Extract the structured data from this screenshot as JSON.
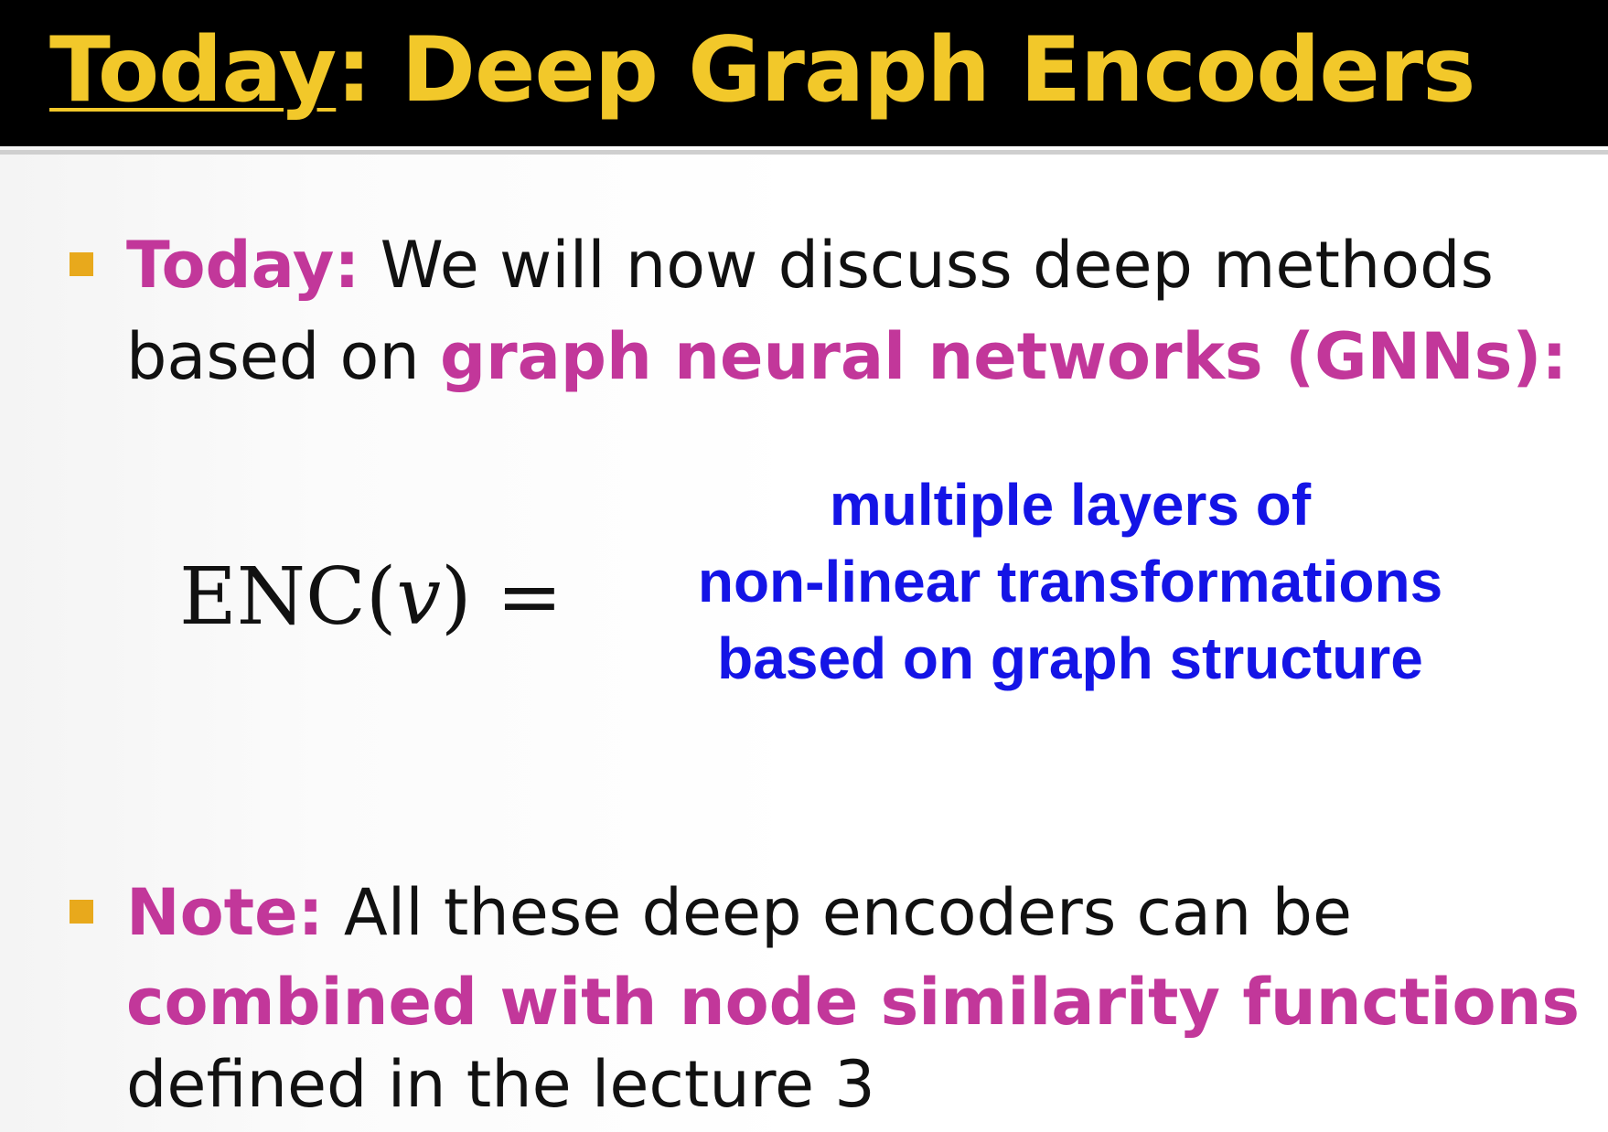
{
  "slide": {
    "title": {
      "underlined": "Today",
      "rest": ": Deep Graph Encoders"
    },
    "bullet1": {
      "lead": "Today:",
      "text1": " We will now discuss deep methods",
      "text2": "based on ",
      "emph": "graph neural networks (GNNs):"
    },
    "formula": {
      "func": "ENC",
      "open": "(",
      "var": "v",
      "close": ")",
      "eq": " ="
    },
    "definition": {
      "line1": "multiple layers of",
      "line2": "non-linear transformations",
      "line3": "based on graph structure"
    },
    "bullet2": {
      "lead": "Note:",
      "text1": " All these deep encoders can be",
      "emph": "combined with node similarity functions",
      "text2": "defined in the lecture 3"
    }
  },
  "colors": {
    "title": "#f2c82a",
    "title_bar": "#000000",
    "highlight": "#c2379a",
    "definition": "#1414e6",
    "bullet": "#e8a91c"
  }
}
